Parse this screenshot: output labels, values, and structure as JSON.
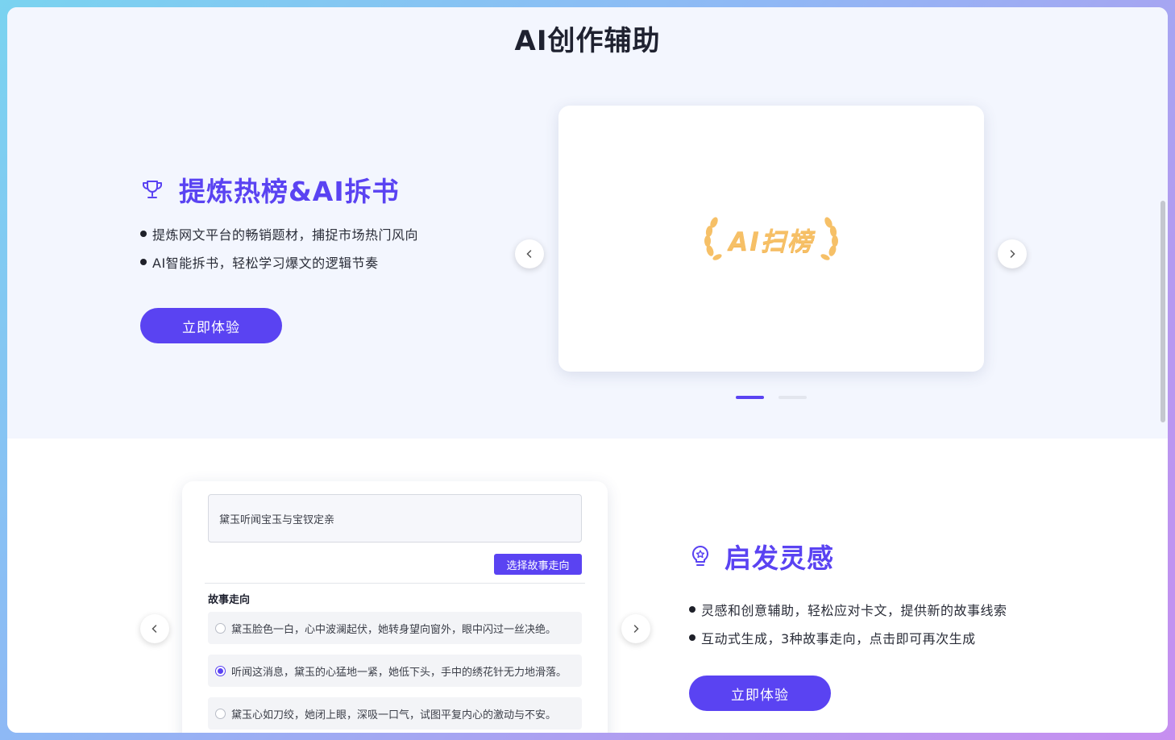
{
  "page": {
    "title": "AI创作辅助"
  },
  "feature1": {
    "title": "提炼热榜&AI拆书",
    "bullets": [
      "提炼网文平台的畅销题材，捕捉市场热门风向",
      "AI智能拆书，轻松学习爆文的逻辑节奏"
    ],
    "cta_label": "立即体验",
    "carousel": {
      "logo_text": "AI扫榜",
      "active_slide": 1,
      "slide_count": 2
    }
  },
  "feature2": {
    "title": "启发灵感",
    "bullets": [
      "灵感和创意辅助，轻松应对卡文，提供新的故事线索",
      "互动式生成，3种故事走向，点击即可再次生成"
    ],
    "cta_label": "立即体验",
    "demo": {
      "input_value": "黛玉听闻宝玉与宝钗定亲",
      "select_button": "选择故事走向",
      "story_label": "故事走向",
      "options": [
        "黛玉脸色一白，心中波澜起伏，她转身望向窗外，眼中闪过一丝决绝。",
        "听闻这消息，黛玉的心猛地一紧，她低下头，手中的绣花针无力地滑落。",
        "黛玉心如刀绞，她闭上眼，深吸一口气，试图平复内心的激动与不安。"
      ],
      "selected_option": 1
    }
  },
  "colors": {
    "accent": "#5a43f2",
    "logo_gold": "#f6c067"
  },
  "icons": {
    "feature1": "trophy-icon",
    "feature2": "lightbulb-icon",
    "prev": "chevron-left-icon",
    "next": "chevron-right-icon"
  }
}
